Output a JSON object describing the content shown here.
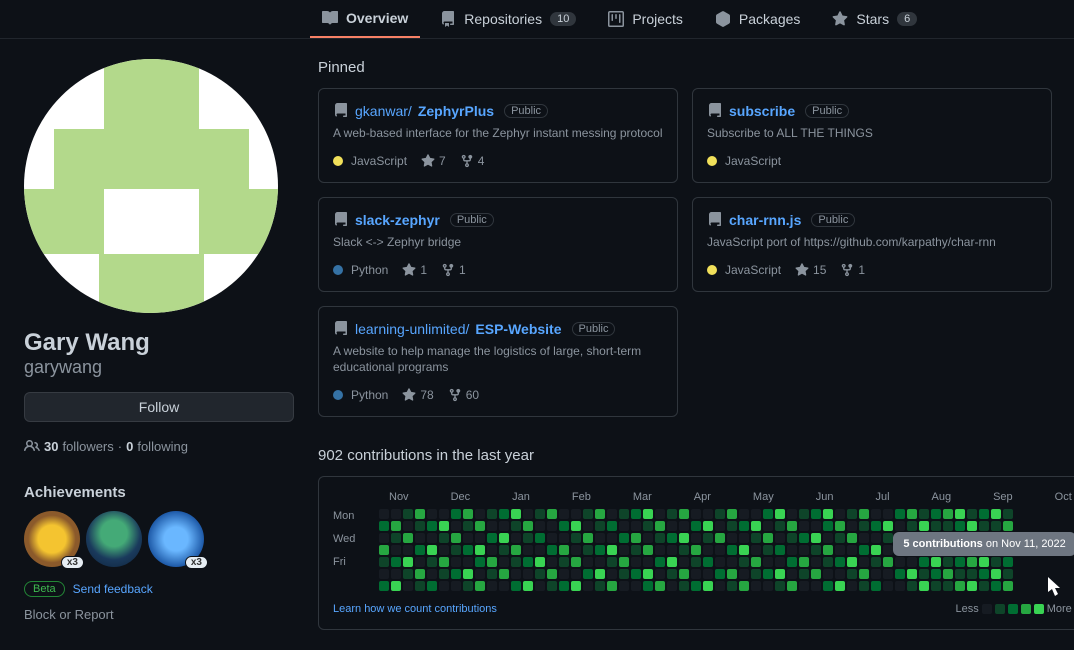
{
  "tabs": {
    "overview": "Overview",
    "repositories": "Repositories",
    "repositories_count": "10",
    "projects": "Projects",
    "packages": "Packages",
    "stars": "Stars",
    "stars_count": "6"
  },
  "profile": {
    "display_name": "Gary Wang",
    "username": "garywang",
    "follow_btn": "Follow",
    "followers_count": "30",
    "followers_label": "followers",
    "following_count": "0",
    "following_label": "following"
  },
  "achievements": {
    "title": "Achievements",
    "items": [
      {
        "badge": "x3"
      },
      {
        "badge": ""
      },
      {
        "badge": "x3"
      }
    ],
    "beta": "Beta",
    "feedback": "Send feedback",
    "block_report": "Block or Report"
  },
  "pinned": {
    "title": "Pinned",
    "repos": [
      {
        "owner": "gkanwar",
        "name": "ZephyrPlus",
        "visibility": "Public",
        "desc": "A web-based interface for the Zephyr instant messing protocol",
        "lang": "JavaScript",
        "lang_color": "#f1e05a",
        "stars": "7",
        "forks": "4"
      },
      {
        "owner": "",
        "name": "subscribe",
        "visibility": "Public",
        "desc": "Subscribe to ALL THE THINGS",
        "lang": "JavaScript",
        "lang_color": "#f1e05a",
        "stars": "",
        "forks": ""
      },
      {
        "owner": "",
        "name": "slack-zephyr",
        "visibility": "Public",
        "desc": "Slack <-> Zephyr bridge",
        "lang": "Python",
        "lang_color": "#3572A5",
        "stars": "1",
        "forks": "1"
      },
      {
        "owner": "",
        "name": "char-rnn.js",
        "visibility": "Public",
        "desc": "JavaScript port of https://github.com/karpathy/char-rnn",
        "lang": "JavaScript",
        "lang_color": "#f1e05a",
        "stars": "15",
        "forks": "1"
      },
      {
        "owner": "learning-unlimited",
        "name": "ESP-Website",
        "visibility": "Public",
        "desc": "A website to help manage the logistics of large, short-term educational programs",
        "lang": "Python",
        "lang_color": "#3572A5",
        "stars": "78",
        "forks": "60"
      }
    ]
  },
  "contributions": {
    "title": "902 contributions in the last year",
    "months": [
      "Nov",
      "Dec",
      "Jan",
      "Feb",
      "Mar",
      "Apr",
      "May",
      "Jun",
      "Jul",
      "Aug",
      "Sep",
      "Oct"
    ],
    "days": [
      "Mon",
      "Wed",
      "Fri"
    ],
    "tooltip_count": "5 contributions",
    "tooltip_date": "on Nov 11, 2022",
    "learn": "Learn how we count contributions",
    "less": "Less",
    "more": "More"
  }
}
